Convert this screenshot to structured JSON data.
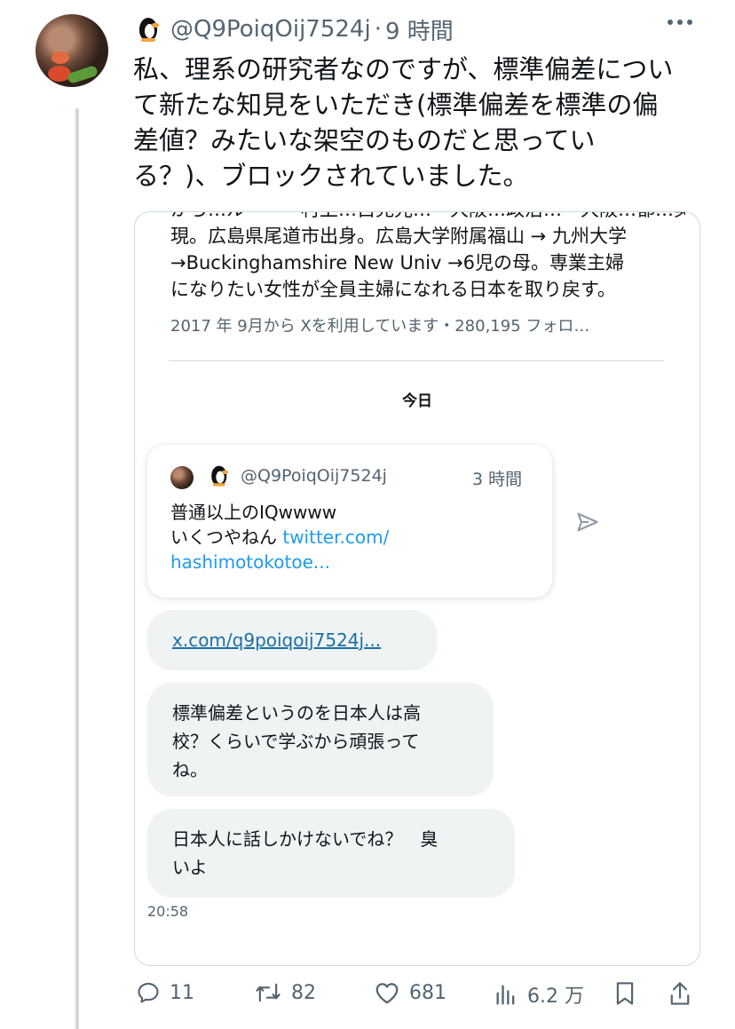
{
  "tweet": {
    "handle": "@Q9PoiqOij7524j",
    "separator": "·",
    "time_ago": "9 時間",
    "text_lines": [
      "私、理系の研究者なのですが、標準偏差につい",
      "て新たな知見をいただき(標準偏差を標準の偏",
      "差値？みたいな架空のものだと思ってい",
      "る？)、ブロックされていました。"
    ]
  },
  "screenshot": {
    "bio_cut_line": "から…ルー・・村上…自見光…・大阪…政治…・大阪…都…実",
    "bio_lines": [
      "現。広島県尾道市出身。広島大学附属福山 → 九州大学",
      "→Buckinghamshire New Univ →6児の母。専業主婦",
      "になりたい女性が全員主婦になれる日本を取り戻す。"
    ],
    "joined": "2017 年 9月から Xを利用しています・280,195 フォロ…",
    "day_label": "今日",
    "quote": {
      "handle": "@Q9PoiqOij7524j",
      "time": "3 時間",
      "line1": "普通以上のIQwwww",
      "line2_text": "いくつやねん ",
      "line2_link": "twitter.com/",
      "line3_link": "hashimotokotoe..."
    },
    "messages": [
      {
        "lines": [
          "x.com/q9poiqoij7524j..."
        ]
      },
      {
        "lines": [
          "標準偏差というのを日本人は高",
          "校？くらいで学ぶから頑張って",
          "ね。"
        ]
      },
      {
        "lines": [
          "日本人に話しかけないでね？　臭",
          "いよ"
        ]
      }
    ],
    "message_time": "20:58"
  },
  "actions": {
    "replies": "11",
    "reposts": "82",
    "likes": "681",
    "views": "6.2 万"
  },
  "colors": {
    "link": "#1d9bf0",
    "secondary_text": "#536471",
    "bubble": "#eff3f4",
    "border": "#cfd9de"
  }
}
